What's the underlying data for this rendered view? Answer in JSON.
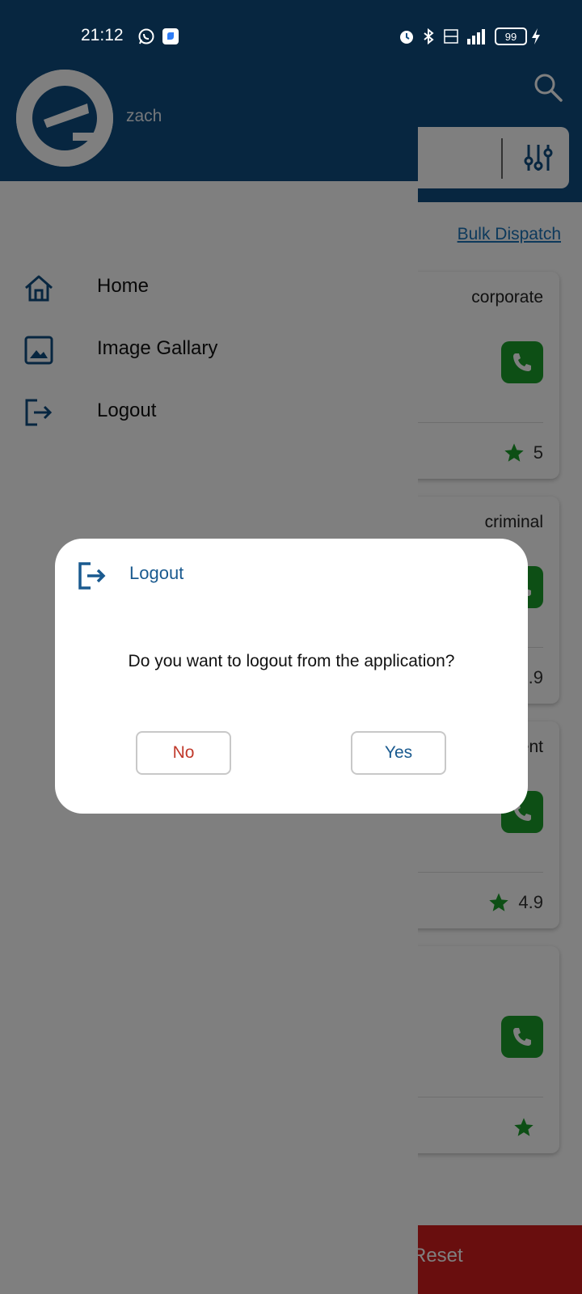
{
  "status_bar": {
    "time": "21:12",
    "battery": "99"
  },
  "background": {
    "bulk_dispatch": "Bulk Dispatch",
    "cards": [
      {
        "type": "corporate",
        "rating": "5"
      },
      {
        "type": "criminal",
        "rating": "4.9"
      },
      {
        "type": "ent",
        "rating": "4.9"
      },
      {
        "type": "",
        "rating": ""
      }
    ],
    "reset_label": "Reset"
  },
  "drawer": {
    "username": "zach",
    "items": [
      {
        "label": "Home",
        "icon": "home-icon"
      },
      {
        "label": "Image Gallary",
        "icon": "image-icon"
      },
      {
        "label": "Logout",
        "icon": "logout-icon"
      }
    ]
  },
  "dialog": {
    "title": "Logout",
    "message": "Do you want to logout from the application?",
    "no_label": "No",
    "yes_label": "Yes"
  },
  "colors": {
    "primary": "#0f4c81",
    "accent_text": "#1a5a8f",
    "no_text": "#c0392b",
    "call_green": "#1a9e2a",
    "reset_red": "#d21c1c"
  }
}
